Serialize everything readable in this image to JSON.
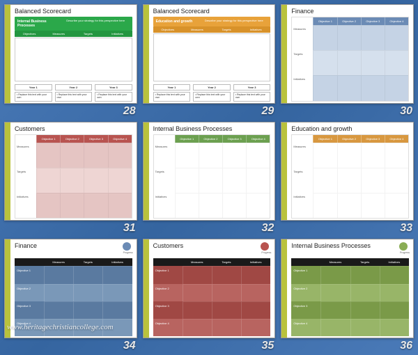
{
  "watermark": "www.heritagechristiancollege.com",
  "common": {
    "objectives": [
      "Objectives",
      "Measures",
      "Targets",
      "Initiatives"
    ],
    "obj_cols": [
      "Objective 1",
      "Objective 2",
      "Objective 3",
      "Objective 4"
    ],
    "row_labels": [
      "Measures",
      "Targets",
      "Initiatives"
    ],
    "year_boxes": [
      "Year 1",
      "Year 2",
      "Year 3"
    ],
    "replace_text": "• Replace this text with your own",
    "blackbar_cols": [
      "Measures",
      "Targets",
      "Initiatives"
    ],
    "block_rows": [
      "Objective 1",
      "Objective 2",
      "Objective 3",
      "Objective 4"
    ],
    "dot_label": "Progress"
  },
  "slides": {
    "s28": {
      "num": "28",
      "title": "Balanced Scorecard",
      "banner_left": "Internal Business Processes",
      "banner_right": "Describe your strategy for this perspective here",
      "banner_color": "#2ba84a",
      "header_color": "#249640"
    },
    "s29": {
      "num": "29",
      "title": "Balanced Scorecard",
      "banner_left": "Education and growth",
      "banner_right": "Describe your strategy for this perspective here",
      "banner_color": "#e8a23a",
      "header_color": "#d8922a"
    },
    "s30": {
      "num": "30",
      "title": "Finance",
      "head_color": "#6b8bb5",
      "cell_color": "#c5d3e5"
    },
    "s31": {
      "num": "31",
      "title": "Customers",
      "head_color": "#b85450",
      "cell_color": "#e5c5c3"
    },
    "s32": {
      "num": "32",
      "title": "Internal Business Processes",
      "head_color": "#6ca050",
      "cell_color": "#ffffff"
    },
    "s33": {
      "num": "33",
      "title": "Education and growth",
      "head_color": "#d89840",
      "cell_color": "#ffffff"
    },
    "s34": {
      "num": "34",
      "title": "Finance",
      "dot_color": "#6b8bb5",
      "block_dark": "#5a7aa0",
      "block_light": "#7a98b8"
    },
    "s35": {
      "num": "35",
      "title": "Customers",
      "dot_color": "#b85450",
      "block_dark": "#a04844",
      "block_light": "#b86460"
    },
    "s36": {
      "num": "36",
      "title": "Internal Business Processes",
      "dot_color": "#8aad55",
      "block_dark": "#7a9a48",
      "block_light": "#98b568"
    }
  }
}
